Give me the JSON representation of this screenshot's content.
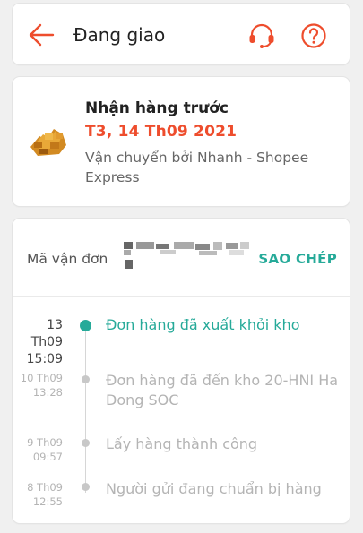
{
  "header": {
    "title": "Đang giao",
    "back_icon": "back-arrow-icon",
    "support_icon": "headset-icon",
    "help_icon": "help-circle-icon"
  },
  "delivery": {
    "heading": "Nhận hàng trước",
    "date": "T3, 14 Th09 2021",
    "carrier": "Vận chuyển bởi Nhanh - Shopee Express"
  },
  "tracking": {
    "label": "Mã vận đơn",
    "copy_label": "SAO CHÉP",
    "events": [
      {
        "day": "13",
        "month": "Th09",
        "time": "15:09",
        "text": "Đơn hàng đã xuất khỏi kho",
        "active": true
      },
      {
        "day": "10 Th09",
        "time": "13:28",
        "text": "Đơn hàng đã đến kho 20-HNI Ha Dong SOC",
        "active": false
      },
      {
        "day": "9 Th09",
        "time": "09:57",
        "text": "Lấy hàng thành công",
        "active": false
      },
      {
        "day": "8 Th09",
        "time": "12:55",
        "text": "Người gửi đang chuẩn bị hàng",
        "active": false
      }
    ]
  },
  "colors": {
    "accent_orange": "#ee4d2d",
    "accent_teal": "#26aa99",
    "muted_text": "#b4b4b4"
  }
}
